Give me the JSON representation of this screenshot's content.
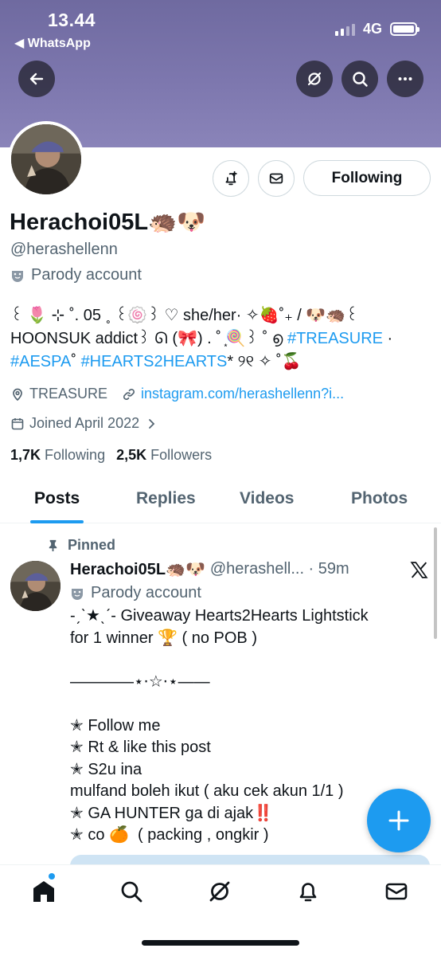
{
  "status_bar": {
    "time": "13.44",
    "back_app": "◀ WhatsApp",
    "network": "4G"
  },
  "profile": {
    "display_name": "Herachoi05L🦔🐶",
    "handle": "@herashellenn",
    "parody_label": "Parody account",
    "bio_line1": "꒰ 🌷 ⊹ ˚. 05 ˳ ꒰🍥꒱ ♡ she/her· ✧🍓˚₊ / 🐶🦔꒰",
    "bio_line2_text": "HOONSUK addict꒱ ᘏ (🎀) . ˚ ͙🍭꒱ ˚ ൭ ",
    "bio_tag1": "#TREASURE",
    "bio_line2_end": " ·",
    "bio_tag2": "#AESPA",
    "bio_sep": "˚ ",
    "bio_tag3": "#HEARTS2HEARTS",
    "bio_line3_end": "* ୨୧ ✧ ˚🍒",
    "location": "TREASURE",
    "link": "instagram.com/herashellenn?i...",
    "joined": "Joined April 2022",
    "following_count": "1,7K",
    "following_label": "Following",
    "followers_count": "2,5K",
    "followers_label": "Followers",
    "following_button": "Following"
  },
  "tabs": [
    "Posts",
    "Replies",
    "Videos",
    "Photos"
  ],
  "post": {
    "pinned_label": "Pinned",
    "name": "Herachoi05L🦔🐶",
    "meta": "@herashell... · 59m",
    "parody_label": "Parody account",
    "body": "-ˏˋ★ˎˊ- Giveaway Hearts2Hearts Lightstick\nfor 1 winner 🏆 ( no POB )\n\n————⋆⋅☆⋅⋆——\n\n✭ Follow me\n✭ Rt & like this post\n✭ S2u ina\nmulfand boleh ikut ( aku cek akun 1/1 )\n✭ GA HUNTER ga di ajak‼️\n✭ co 🍊  ( packing , ongkir )"
  },
  "icons": {
    "back": "arrow-left-icon",
    "grok": "grok-icon",
    "search": "search-icon",
    "more": "more-icon",
    "notify": "bell-plus-icon",
    "message": "envelope-icon"
  },
  "colors": {
    "accent": "#1d9bf0",
    "banner": "#7d77ae",
    "text": "#0f1419",
    "muted": "#536471"
  }
}
